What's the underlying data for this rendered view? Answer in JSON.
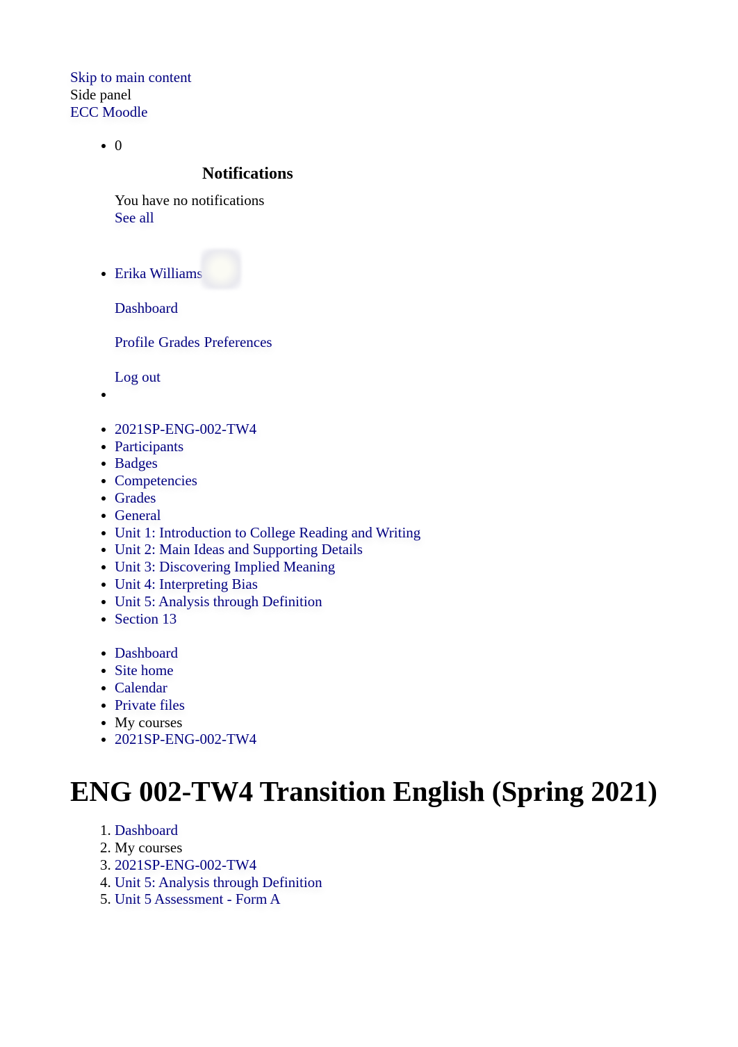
{
  "header": {
    "skip_link": "Skip to main content",
    "side_panel": "Side panel",
    "site_name": "ECC Moodle"
  },
  "notifications": {
    "count": "0",
    "title": "Notifications",
    "empty_message": "You have no notifications",
    "see_all": "See all"
  },
  "user_menu": {
    "avatar_icon": "user-avatar",
    "name": "Erika Williams",
    "dashboard": "Dashboard",
    "profile": "Profile",
    "grades": "Grades",
    "preferences": "Preferences",
    "logout": "Log out"
  },
  "course_nav": {
    "items": [
      "2021SP-ENG-002-TW4",
      "Participants",
      "Badges",
      "Competencies",
      "Grades",
      "General",
      "Unit 1: Introduction to College Reading and Writing",
      "Unit 2: Main Ideas and Supporting Details",
      "Unit 3: Discovering Implied Meaning",
      "Unit 4: Interpreting Bias",
      "Unit 5: Analysis through Definition",
      "Section 13"
    ]
  },
  "site_nav": {
    "items": [
      {
        "label": "Dashboard",
        "link": true
      },
      {
        "label": "Site home",
        "link": true
      },
      {
        "label": "Calendar",
        "link": true
      },
      {
        "label": "Private files",
        "link": true
      },
      {
        "label": "My courses",
        "link": false
      },
      {
        "label": "2021SP-ENG-002-TW4",
        "link": true
      }
    ]
  },
  "page": {
    "title": "ENG 002-TW4 Transition English (Spring 2021)"
  },
  "breadcrumb": {
    "items": [
      {
        "label": "Dashboard",
        "link": true
      },
      {
        "label": "My courses",
        "link": false
      },
      {
        "label": "2021SP-ENG-002-TW4",
        "link": true
      },
      {
        "label": "Unit 5: Analysis through Definition",
        "link": true
      },
      {
        "label": "Unit 5 Assessment - Form A",
        "link": true
      }
    ]
  },
  "colors": {
    "link": "#000080",
    "text": "#000000",
    "background": "#ffffff"
  }
}
